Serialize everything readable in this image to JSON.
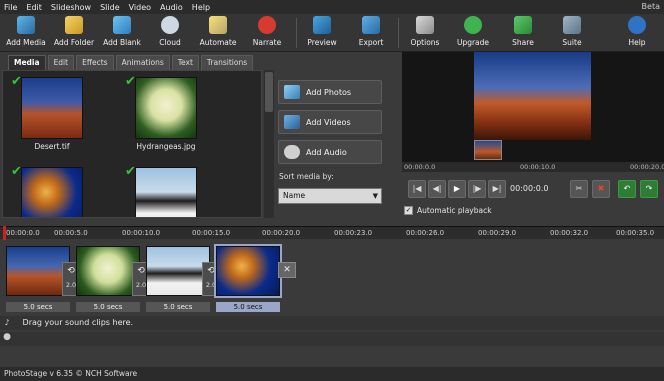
{
  "app": {
    "beta": "Beta",
    "status": "PhotoStage v 6.35 © NCH Software"
  },
  "menu": [
    "File",
    "Edit",
    "Slideshow",
    "Slide",
    "Video",
    "Audio",
    "Help"
  ],
  "toolbar": {
    "add_media": "Add Media",
    "add_folder": "Add Folder",
    "add_blank": "Add Blank",
    "cloud": "Cloud",
    "automate": "Automate",
    "narrate": "Narrate",
    "preview": "Preview",
    "export": "Export",
    "options": "Options",
    "upgrade": "Upgrade",
    "share": "Share",
    "suite": "Suite",
    "help": "Help"
  },
  "tabs": [
    "Media",
    "Edit",
    "Effects",
    "Animations",
    "Text",
    "Transitions"
  ],
  "media": [
    {
      "name": "Desert.tif",
      "icon": "desert-thumbnail"
    },
    {
      "name": "Hydrangeas.jpg",
      "icon": "hydrangeas-thumbnail"
    },
    {
      "name": "",
      "icon": "jellyfish-thumbnail"
    },
    {
      "name": "",
      "icon": "penguins-thumbnail"
    }
  ],
  "side": {
    "add_photos": "Add Photos",
    "add_videos": "Add Videos",
    "add_audio": "Add Audio",
    "sort_label": "Sort media by:",
    "sort_value": "Name"
  },
  "preview": {
    "ruler": [
      "00:00:0.0",
      "00:00:10.0",
      "00:00:20.0"
    ],
    "time": "00:00:0.0",
    "auto_playback": "Automatic playback"
  },
  "timeline": {
    "ruler": [
      "00:00:0.0",
      "00:00:5.0",
      "00:00:10.0",
      "00:00:15.0",
      "00:00:20.0",
      "00:00:23.0",
      "00:00:26.0",
      "00:00:29.0",
      "00:00:32.0",
      "00:00:35.0"
    ],
    "clips": [
      {
        "duration": "5.0 secs",
        "transition": "2.0"
      },
      {
        "duration": "5.0 secs",
        "transition": "2.0"
      },
      {
        "duration": "5.0 secs",
        "transition": "2.0"
      },
      {
        "duration": "5.0 secs"
      }
    ],
    "sound_hint": "Drag your sound clips here."
  },
  "colors": {
    "accent_green": "#38c23c",
    "playhead_red": "#d21f1f",
    "selection": "#9aa6c8"
  }
}
